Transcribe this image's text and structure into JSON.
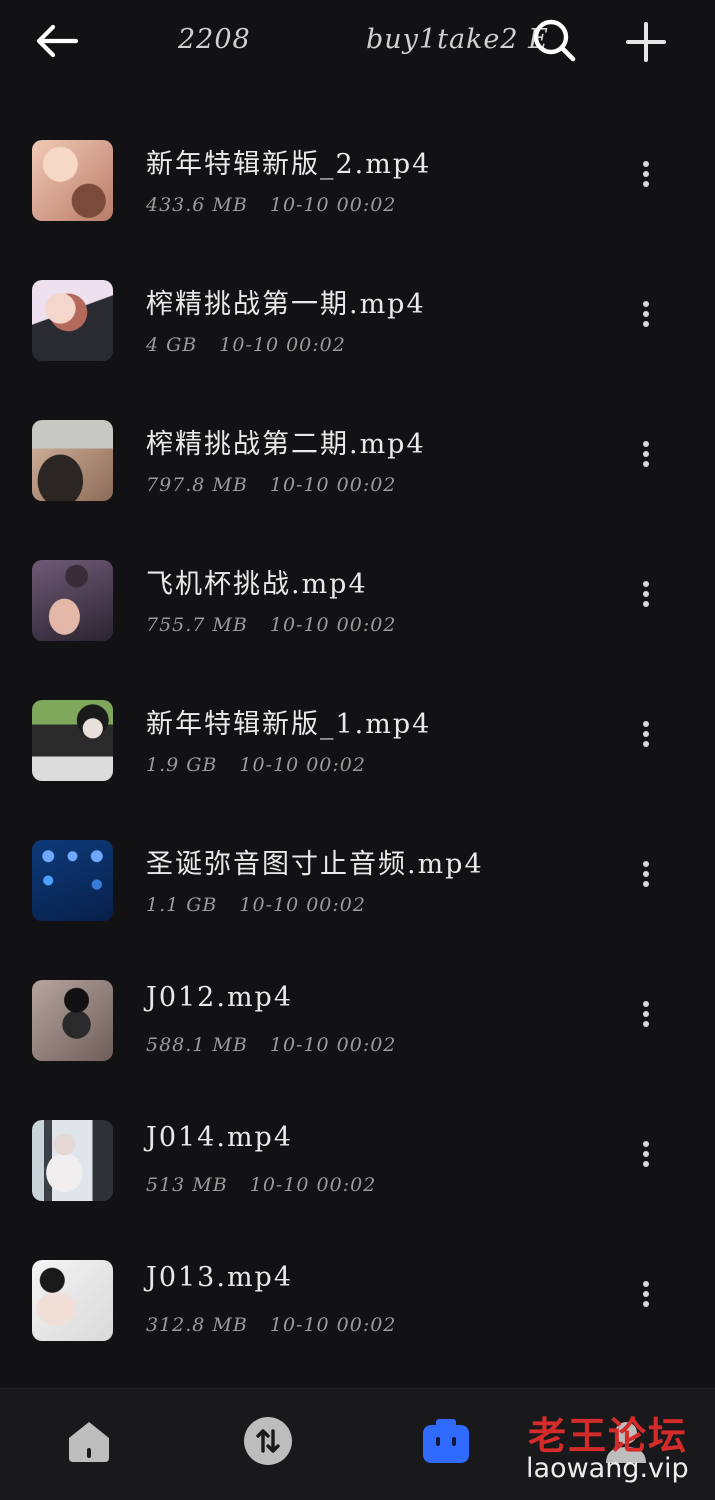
{
  "header": {
    "back_icon": "arrow-left-icon",
    "breadcrumbs": [
      "2208",
      "buy1take2 Ed"
    ],
    "search_icon": "search-icon",
    "add_icon": "plus-icon"
  },
  "files": [
    {
      "name": "新年特辑新版_2.mp4",
      "size": "433.6 MB",
      "date": "10-10 00:02",
      "thumb": "t1"
    },
    {
      "name": "榨精挑战第一期.mp4",
      "size": "4 GB",
      "date": "10-10 00:02",
      "thumb": "t2"
    },
    {
      "name": "榨精挑战第二期.mp4",
      "size": "797.8 MB",
      "date": "10-10 00:02",
      "thumb": "t3"
    },
    {
      "name": "飞机杯挑战.mp4",
      "size": "755.7 MB",
      "date": "10-10 00:02",
      "thumb": "t4"
    },
    {
      "name": "新年特辑新版_1.mp4",
      "size": "1.9 GB",
      "date": "10-10 00:02",
      "thumb": "t5"
    },
    {
      "name": "圣诞弥音图寸止音频.mp4",
      "size": "1.1 GB",
      "date": "10-10 00:02",
      "thumb": "t6"
    },
    {
      "name": "J012.mp4",
      "size": "588.1 MB",
      "date": "10-10 00:02",
      "thumb": "t7"
    },
    {
      "name": "J014.mp4",
      "size": "513 MB",
      "date": "10-10 00:02",
      "thumb": "t8"
    },
    {
      "name": "J013.mp4",
      "size": "312.8 MB",
      "date": "10-10 00:02",
      "thumb": "t9"
    }
  ],
  "bottom_nav": [
    {
      "icon": "home-icon"
    },
    {
      "icon": "transfer-icon"
    },
    {
      "icon": "files-icon",
      "active": true
    },
    {
      "icon": "profile-icon"
    }
  ],
  "colors": {
    "background": "#121214",
    "nav_background": "#19191c",
    "active_accent": "#2f6bff",
    "watermark_red": "#d42b2b"
  },
  "watermark": {
    "title": "老王论坛",
    "url": "laowang.vip"
  }
}
